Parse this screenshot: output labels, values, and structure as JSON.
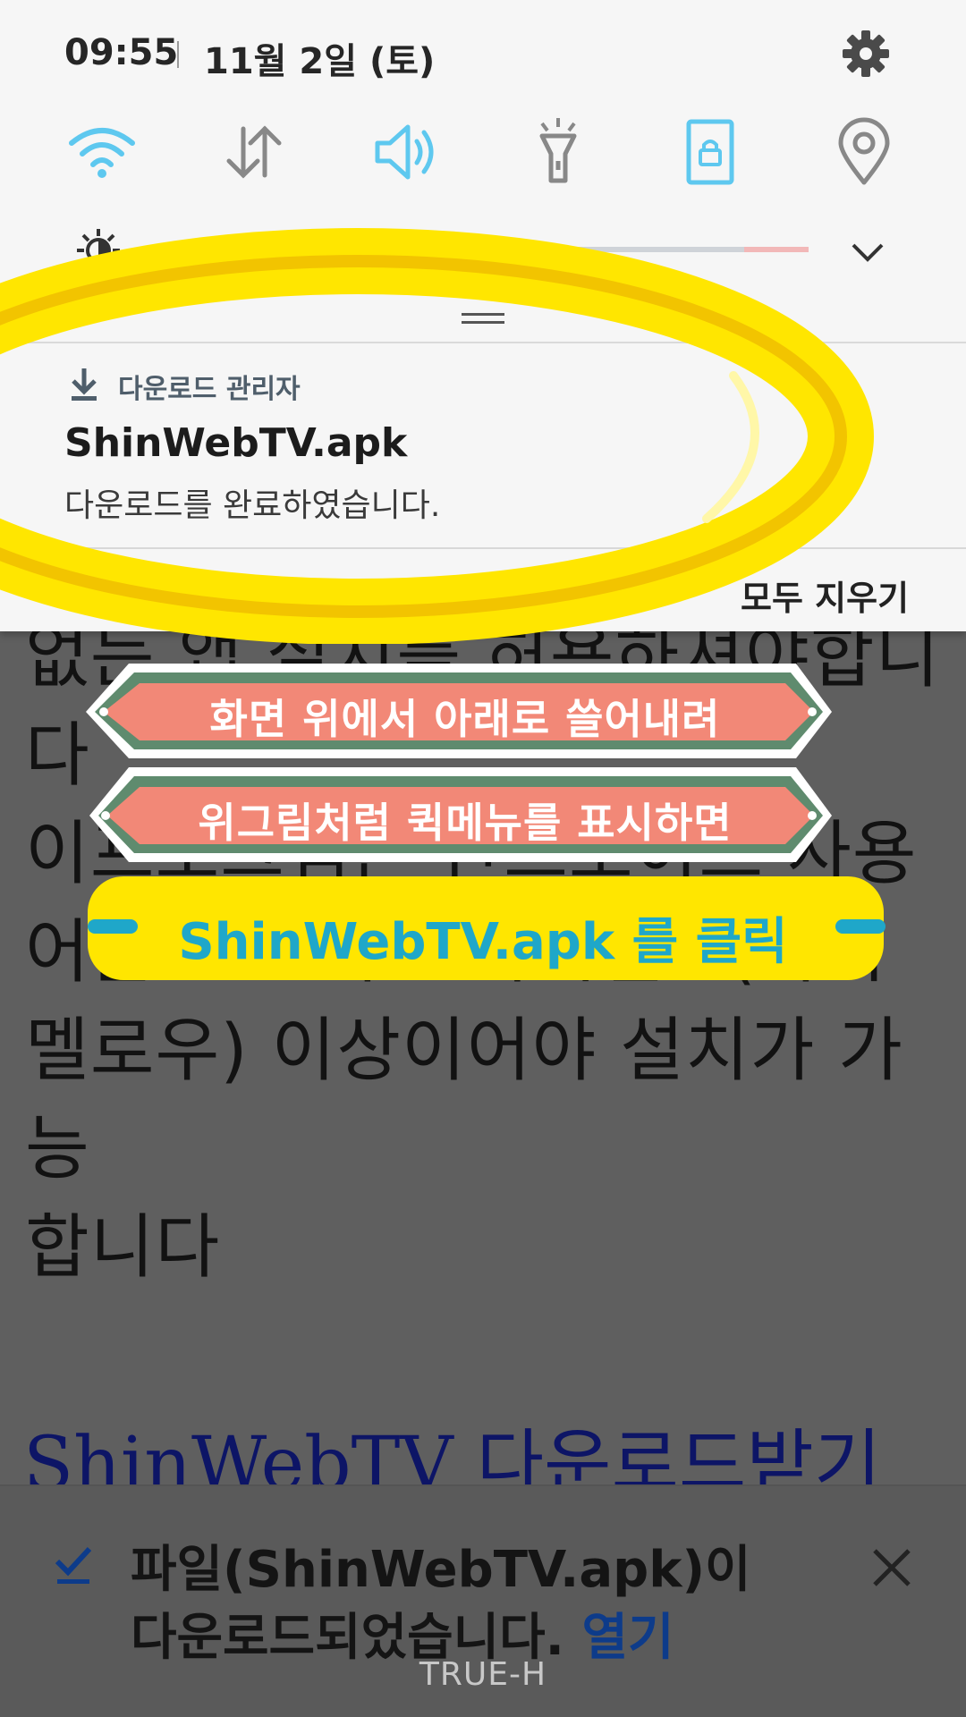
{
  "status_bar": {
    "time": "09:55",
    "date": "11월 2일 (토)"
  },
  "quick_settings": {
    "icons": [
      "wifi-icon",
      "mobile-data-icon",
      "sound-icon",
      "flashlight-icon",
      "screen-rotation-lock-icon",
      "location-icon"
    ],
    "brightness_level": 0.36,
    "accent_color": "#5ec8ef"
  },
  "notification": {
    "app_name": "다운로드 관리자",
    "title": "ShinWebTV.apk",
    "text": "다운로드를 완료하였습니다.",
    "left_action": "설정",
    "clear_all": "모두 지우기"
  },
  "annotations": {
    "banner1": "화면 위에서 아래로 쓸어내려",
    "banner2": "위그림처럼 퀵메뉴를 표시하면",
    "callout": "ShinWebTV.apk 를 클릭",
    "highlight_color": "#ffe600"
  },
  "webpage": {
    "body_text": "없는 앱 설치를 허용하셔야합니\n다\n이프로그램은 안드로이드 사용\n어플 6.0 버전 마시멜로(마시\n멜로우) 이상이어야 설치가 가능\n합니다",
    "link": "ShinWebTV 다운로드받기"
  },
  "download_bar": {
    "message": "파일(ShinWebTV.apk)이 다운로드되었습니다.",
    "open_label": "열기"
  },
  "watermark": "TRUE-H"
}
